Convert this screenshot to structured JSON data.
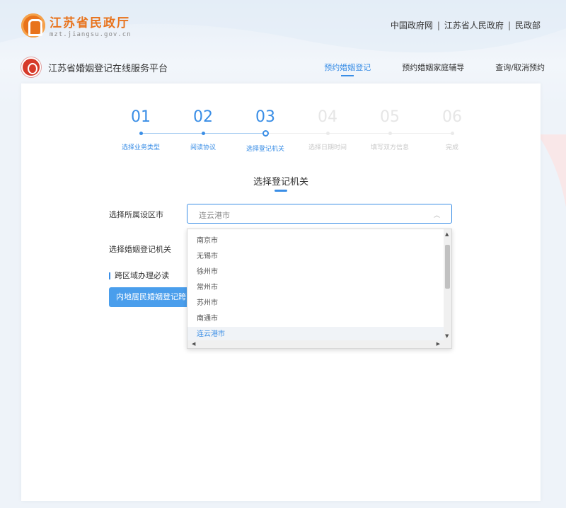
{
  "header": {
    "site_title": "江苏省民政厅",
    "site_url": "mzt.jiangsu.gov.cn",
    "links": [
      "中国政府网",
      "江苏省人民政府",
      "民政部"
    ],
    "separator": "|"
  },
  "platform": {
    "title": "江苏省婚姻登记在线服务平台",
    "nav": [
      {
        "label": "预约婚姻登记",
        "active": true
      },
      {
        "label": "预约婚姻家庭辅导",
        "active": false
      },
      {
        "label": "查询/取消预约",
        "active": false
      }
    ]
  },
  "steps": [
    {
      "num": "01",
      "label": "选择业务类型",
      "state": "done"
    },
    {
      "num": "02",
      "label": "阅读协议",
      "state": "done"
    },
    {
      "num": "03",
      "label": "选择登记机关",
      "state": "current"
    },
    {
      "num": "04",
      "label": "选择日期时间",
      "state": "todo"
    },
    {
      "num": "05",
      "label": "填写双方信息",
      "state": "todo"
    },
    {
      "num": "06",
      "label": "完成",
      "state": "todo"
    }
  ],
  "form": {
    "section_title": "选择登记机关",
    "city_label": "选择所属设区市",
    "city_value": "连云港市",
    "office_label": "选择婚姻登记机关",
    "notice_title": "跨区域办理必读",
    "notice_button": "内地居民婚姻登记跨区"
  },
  "dropdown": {
    "options": [
      "南京市",
      "无锡市",
      "徐州市",
      "常州市",
      "苏州市",
      "南通市",
      "连云港市"
    ],
    "selected": "连云港市"
  },
  "colors": {
    "accent": "#3a8ee6",
    "brand_orange": "#e8731c",
    "brand_red": "#d63a2a"
  }
}
